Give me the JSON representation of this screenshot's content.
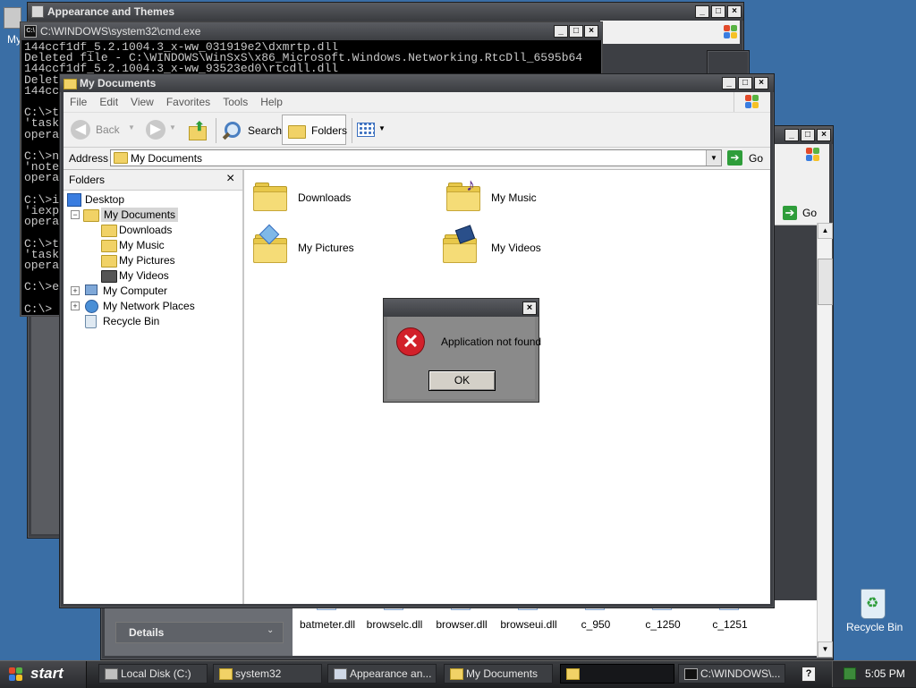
{
  "desktop": {
    "partial_icon_label": "My",
    "recycle_bin_label": "Recycle Bin"
  },
  "appearance_window": {
    "title": "Appearance and Themes"
  },
  "cmd_window": {
    "title": "C:\\WINDOWS\\system32\\cmd.exe",
    "lines": [
      "144ccf1df_5.2.1004.3_x-ww_031919e2\\dxmrtp.dll",
      "Deleted file - C:\\WINDOWS\\WinSxS\\x86_Microsoft.Windows.Networking.RtcDll_6595b64",
      "144ccf1df_5.2.1004.3_x-ww_93523ed0\\rtcdll.dll",
      "Delet",
      "144cc",
      "",
      "C:\\>t",
      "'task",
      "opera",
      "",
      "C:\\>n",
      "'note",
      "opera",
      "",
      "C:\\>i",
      "'iexp",
      "opera",
      "",
      "C:\\>t",
      "'task",
      "opera",
      "",
      "C:\\>e",
      "",
      "C:\\>"
    ]
  },
  "back_explorer": {
    "go_label": "Go",
    "details_label": "Details",
    "files": [
      "batmeter.dll",
      "browselc.dll",
      "browser.dll",
      "browseui.dll",
      "c_950",
      "c_1250",
      "c_1251"
    ]
  },
  "explorer": {
    "title": "My Documents",
    "menu": [
      "File",
      "Edit",
      "View",
      "Favorites",
      "Tools",
      "Help"
    ],
    "toolbar": {
      "back": "Back",
      "search": "Search",
      "folders": "Folders"
    },
    "address": {
      "label": "Address",
      "value": "My Documents",
      "go": "Go"
    },
    "folders_pane": {
      "header": "Folders",
      "close": "×",
      "tree": [
        "Desktop",
        "My Documents",
        "Downloads",
        "My Music",
        "My Pictures",
        "My Videos",
        "My Computer",
        "My Network Places",
        "Recycle Bin"
      ]
    },
    "items": [
      "Downloads",
      "My Music",
      "My Pictures",
      "My Videos"
    ]
  },
  "dialog": {
    "message": "Application not found",
    "ok": "OK",
    "close": "×"
  },
  "taskbar": {
    "start": "start",
    "buttons": [
      "Local Disk (C:)",
      "system32",
      "Appearance an...",
      "My Documents",
      "",
      "C:\\WINDOWS\\..."
    ],
    "clock": "5:05 PM"
  },
  "colors": {
    "desktop": "#3a6ea5",
    "window_frame": "#3d3f44",
    "folder_yellow": "#f1d266",
    "error_red": "#d2202a"
  }
}
